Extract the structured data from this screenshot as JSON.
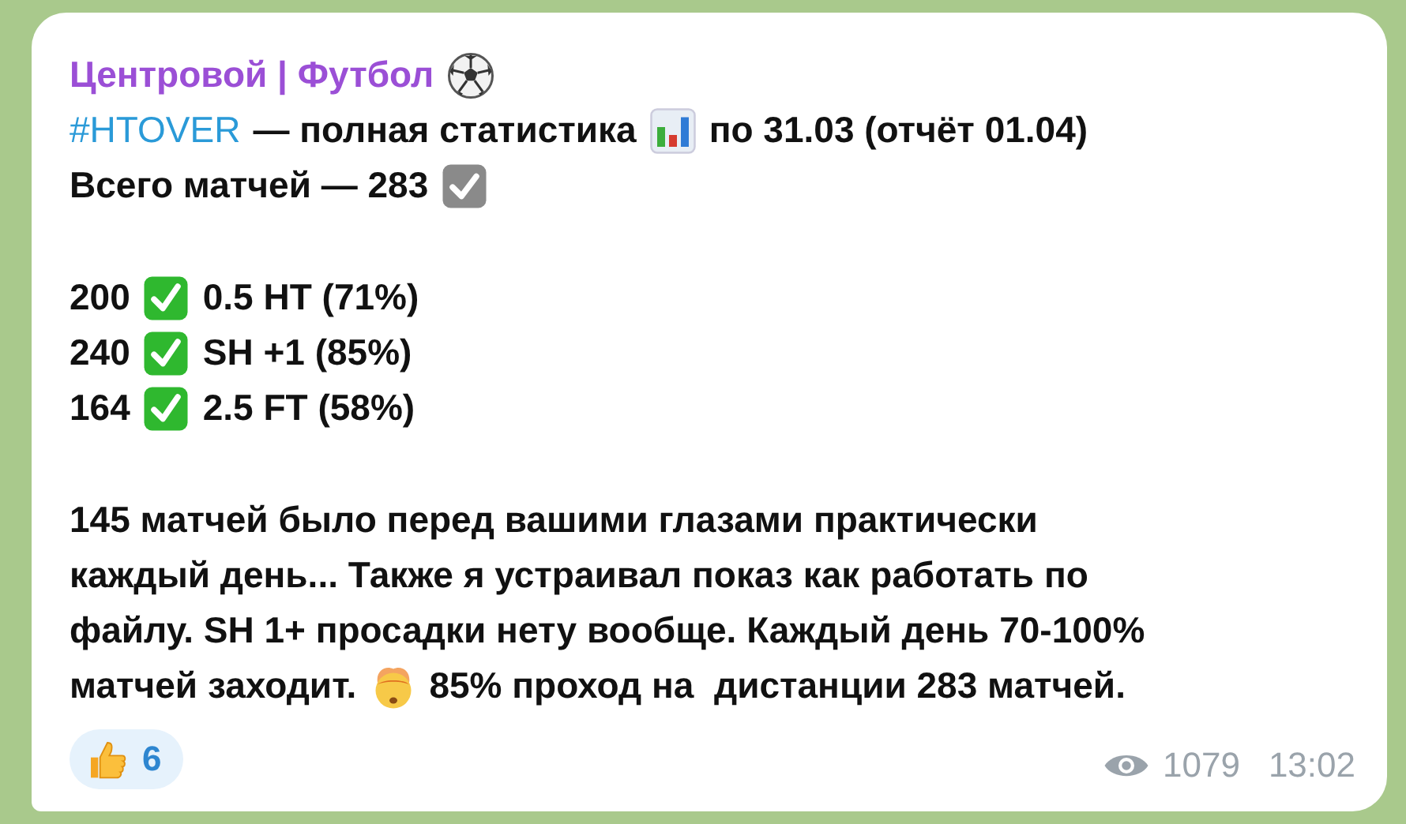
{
  "channel": {
    "name": "Центровой | Футбол"
  },
  "headline": {
    "hashtag": "#HTOVER",
    "before_icon": "— полная статистика",
    "after_icon": "по 31.03 (отчёт 01.04)"
  },
  "total": {
    "text": "Всего матчей — 283"
  },
  "results": [
    {
      "count": "200",
      "label": "0.5 HT (71%)"
    },
    {
      "count": "240",
      "label": "SH +1 (85%)"
    },
    {
      "count": "164",
      "label": "2.5 FT (58%)"
    }
  ],
  "paragraph": {
    "lines": [
      "145 матчей было перед вашими глазами практически",
      "каждый день... Также я устраивал показ как работать по",
      "файлу. SH 1+ просадки нету вообще. Каждый день 70-100%"
    ],
    "last_before_icon": "матчей заходит.",
    "last_after_icon": "85% проход на  дистанции 283 матчей."
  },
  "reactions": [
    {
      "count": "6",
      "selected": false
    }
  ],
  "views": "1079",
  "time": "13:02"
}
